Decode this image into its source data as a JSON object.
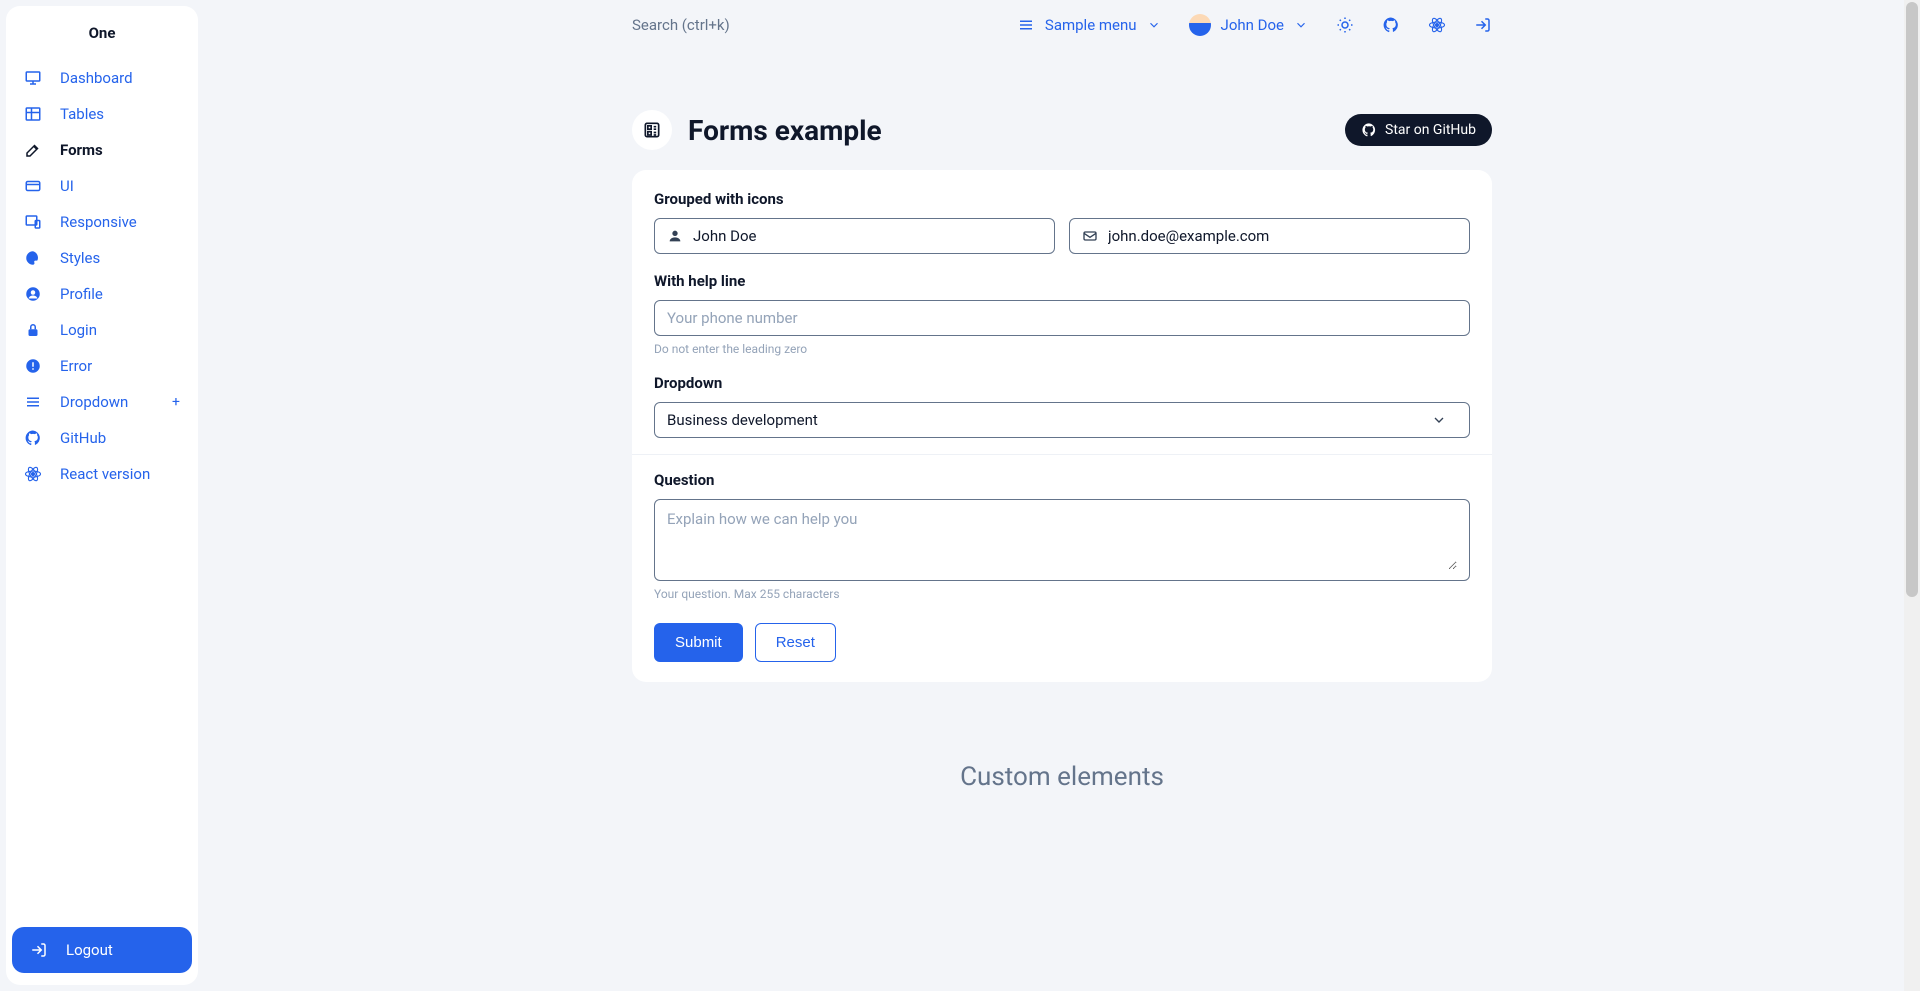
{
  "brand": "One",
  "sidebar": {
    "items": [
      {
        "label": "Dashboard",
        "icon": "monitor",
        "active": false
      },
      {
        "label": "Tables",
        "icon": "table",
        "active": false
      },
      {
        "label": "Forms",
        "icon": "edit",
        "active": true
      },
      {
        "label": "UI",
        "icon": "card",
        "active": false
      },
      {
        "label": "Responsive",
        "icon": "responsive",
        "active": false
      },
      {
        "label": "Styles",
        "icon": "palette",
        "active": false
      },
      {
        "label": "Profile",
        "icon": "user-circle",
        "active": false
      },
      {
        "label": "Login",
        "icon": "lock",
        "active": false
      },
      {
        "label": "Error",
        "icon": "alert",
        "active": false
      },
      {
        "label": "Dropdown",
        "icon": "list",
        "active": false,
        "expandable": true
      },
      {
        "label": "GitHub",
        "icon": "github",
        "active": false
      },
      {
        "label": "React version",
        "icon": "react",
        "active": false
      }
    ],
    "logout_label": "Logout"
  },
  "topbar": {
    "search_placeholder": "Search (ctrl+k)",
    "sample_menu_label": "Sample menu",
    "user_name": "John Doe"
  },
  "page": {
    "title": "Forms example",
    "star_label": "Star on GitHub"
  },
  "form": {
    "grouped_label": "Grouped with icons",
    "name_value": "John Doe",
    "email_value": "john.doe@example.com",
    "help_label": "With help line",
    "phone_placeholder": "Your phone number",
    "phone_help": "Do not enter the leading zero",
    "dropdown_label": "Dropdown",
    "dropdown_value": "Business development",
    "question_label": "Question",
    "question_placeholder": "Explain how we can help you",
    "question_help": "Your question. Max 255 characters",
    "submit_label": "Submit",
    "reset_label": "Reset"
  },
  "custom_heading": "Custom elements"
}
